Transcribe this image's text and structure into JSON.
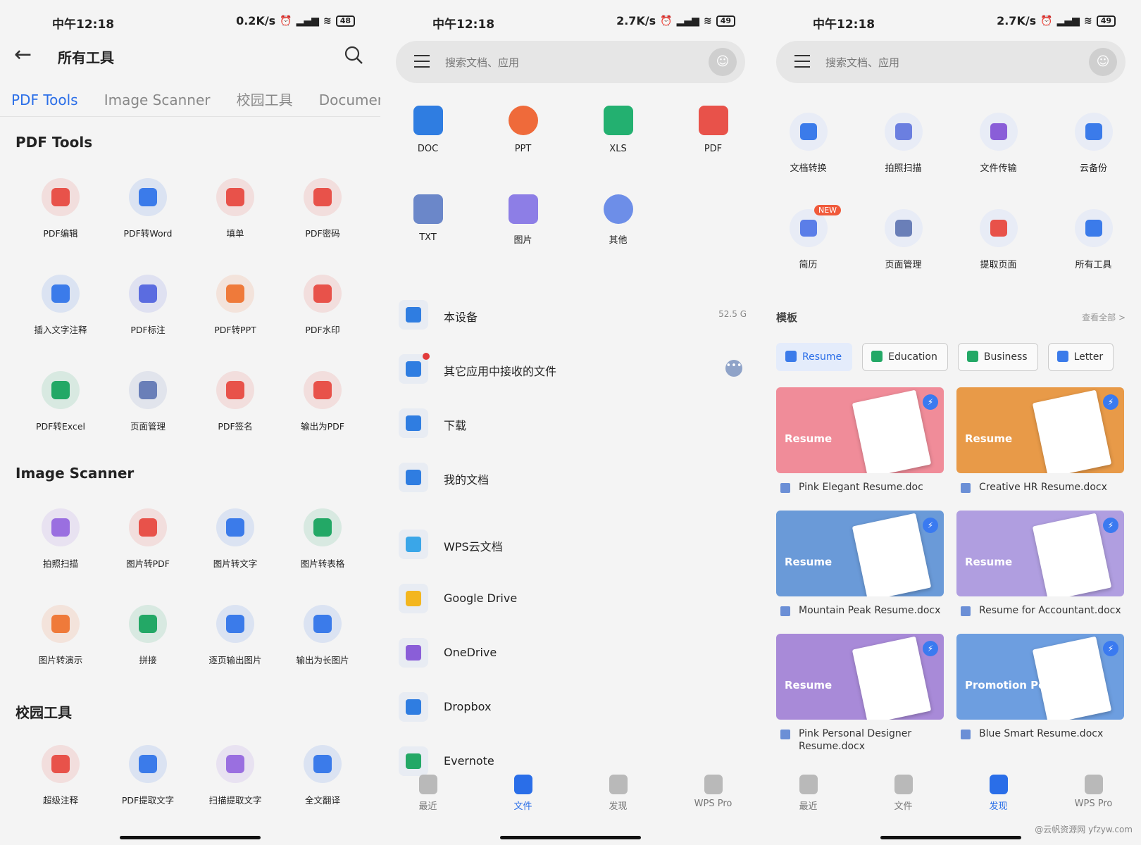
{
  "status_left": {
    "time": "中午12:18",
    "speed": "0.2K/s",
    "battery": "48"
  },
  "status_mid": {
    "time": "中午12:18",
    "speed": "2.7K/s",
    "battery": "49"
  },
  "status_right": {
    "time": "中午12:18",
    "speed": "2.7K/s",
    "battery": "49"
  },
  "tools_page": {
    "title": "所有工具",
    "tabs": [
      "PDF Tools",
      "Image Scanner",
      "校园工具",
      "Document"
    ],
    "sections": [
      {
        "title": "PDF Tools",
        "items": [
          {
            "label": "PDF编辑",
            "color": "#e8524a"
          },
          {
            "label": "PDF转Word",
            "color": "#3b7bea"
          },
          {
            "label": "填单",
            "color": "#e8524a"
          },
          {
            "label": "PDF密码",
            "color": "#e8524a"
          },
          {
            "label": "插入文字注释",
            "color": "#3b7bea"
          },
          {
            "label": "PDF标注",
            "color": "#5b6ce0"
          },
          {
            "label": "PDF转PPT",
            "color": "#ef7a3a"
          },
          {
            "label": "PDF水印",
            "color": "#e8524a"
          },
          {
            "label": "PDF转Excel",
            "color": "#23a866"
          },
          {
            "label": "页面管理",
            "color": "#6a7fb8"
          },
          {
            "label": "PDF签名",
            "color": "#e8524a"
          },
          {
            "label": "输出为PDF",
            "color": "#e8524a"
          }
        ]
      },
      {
        "title": "Image Scanner",
        "items": [
          {
            "label": "拍照扫描",
            "color": "#9a6fe0"
          },
          {
            "label": "图片转PDF",
            "color": "#e8524a"
          },
          {
            "label": "图片转文字",
            "color": "#3b7bea"
          },
          {
            "label": "图片转表格",
            "color": "#23a866"
          },
          {
            "label": "图片转演示",
            "color": "#ef7a3a"
          },
          {
            "label": "拼接",
            "color": "#23a866"
          },
          {
            "label": "逐页输出图片",
            "color": "#3b7bea"
          },
          {
            "label": "输出为长图片",
            "color": "#3b7bea"
          }
        ]
      },
      {
        "title": "校园工具",
        "items": [
          {
            "label": "超级注释",
            "color": "#e8524a"
          },
          {
            "label": "PDF提取文字",
            "color": "#3b7bea"
          },
          {
            "label": "扫描提取文字",
            "color": "#9a6fe0"
          },
          {
            "label": "全文翻译",
            "color": "#3b7bea"
          }
        ]
      }
    ]
  },
  "files_page": {
    "search_placeholder": "搜索文档、应用",
    "file_types": [
      {
        "label": "DOC",
        "color": "#2f7de1"
      },
      {
        "label": "PPT",
        "color": "#ef6a3a"
      },
      {
        "label": "XLS",
        "color": "#23b070"
      },
      {
        "label": "PDF",
        "color": "#e8524a"
      },
      {
        "label": "TXT",
        "color": "#6b87c9"
      },
      {
        "label": "图片",
        "color": "#8d7ee6"
      },
      {
        "label": "其他",
        "color": "#6d8ee8"
      }
    ],
    "locations": [
      {
        "label": "本设备",
        "meta": "52.5 G",
        "color": "#2f7de1"
      },
      {
        "label": "其它应用中接收的文件",
        "meta": "",
        "color": "#2f7de1"
      },
      {
        "label": "下载",
        "meta": "",
        "color": "#2f7de1"
      },
      {
        "label": "我的文档",
        "meta": "",
        "color": "#2f7de1"
      },
      {
        "label": "WPS云文档",
        "meta": "",
        "color": "#3aa6e8"
      },
      {
        "label": "Google Drive",
        "meta": "",
        "color": "#f3b61f"
      },
      {
        "label": "OneDrive",
        "meta": "",
        "color": "#8a5ed8"
      },
      {
        "label": "Dropbox",
        "meta": "",
        "color": "#2f7de1"
      },
      {
        "label": "Evernote",
        "meta": "",
        "color": "#23a866"
      }
    ],
    "nav": [
      "最近",
      "文件",
      "发现",
      "WPS Pro"
    ]
  },
  "discover_page": {
    "search_placeholder": "搜索文档、应用",
    "features": [
      {
        "label": "文档转换",
        "color": "#3b7bea"
      },
      {
        "label": "拍照扫描",
        "color": "#6b7fe0"
      },
      {
        "label": "文件传输",
        "color": "#8a5ed8"
      },
      {
        "label": "云备份",
        "color": "#3b7bea"
      },
      {
        "label": "简历",
        "color": "#5b7ee8",
        "badge": "NEW"
      },
      {
        "label": "页面管理",
        "color": "#6a7fb8"
      },
      {
        "label": "提取页面",
        "color": "#e8524a"
      },
      {
        "label": "所有工具",
        "color": "#3b7bea"
      }
    ],
    "templates_title": "模板",
    "see_all": "查看全部 >",
    "chips": [
      {
        "label": "Resume",
        "color": "#3b7bea"
      },
      {
        "label": "Education",
        "color": "#23a866"
      },
      {
        "label": "Business",
        "color": "#23a866"
      },
      {
        "label": "Letter",
        "color": "#3b7bea"
      }
    ],
    "templates": [
      {
        "name": "Pink Elegant Resume.doc",
        "thumb_text": "Resume",
        "bg": "#f08c99"
      },
      {
        "name": "Creative HR Resume.docx",
        "thumb_text": "Resume",
        "bg": "#e89a48"
      },
      {
        "name": "Mountain Peak Resume.docx",
        "thumb_text": "Resume",
        "bg": "#6a9ad8"
      },
      {
        "name": "Resume for Accountant.docx",
        "thumb_text": "Resume",
        "bg": "#b09ee0"
      },
      {
        "name": "Pink Personal Designer Resume.docx",
        "thumb_text": "Resume",
        "bg": "#a88ad8"
      },
      {
        "name": "Blue Smart Resume.docx",
        "thumb_text": "Promotion Poster",
        "bg": "#6d9ee0"
      }
    ],
    "nav": [
      "最近",
      "文件",
      "发现",
      "WPS Pro"
    ],
    "watermark": "@云帆资源网 yfzyw.com"
  }
}
